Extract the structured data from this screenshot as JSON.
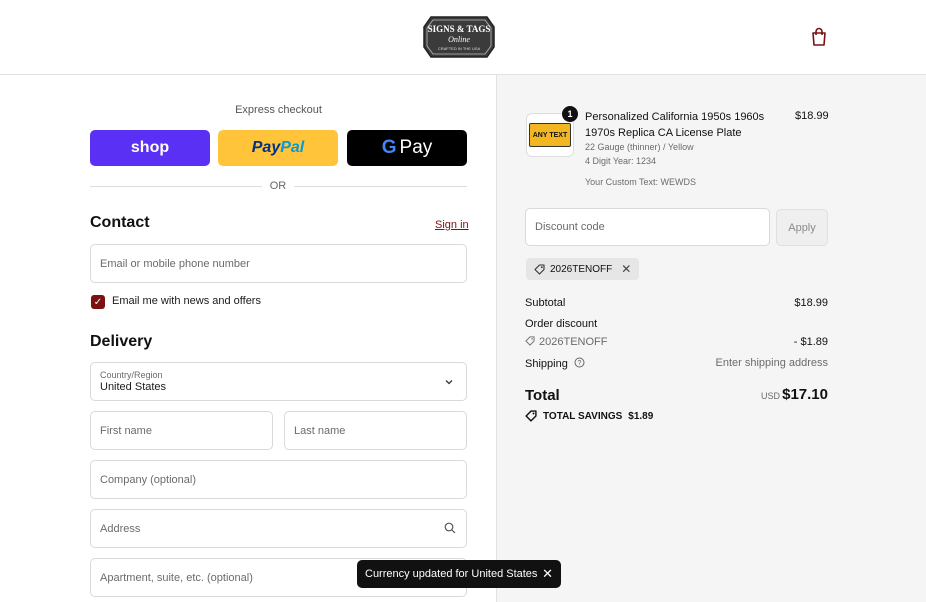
{
  "header": {
    "logo_line1": "SIGNS & TAGS",
    "logo_line2": "Online",
    "logo_line3": "CRAFTED IN THE USA"
  },
  "express": {
    "title": "Express checkout",
    "shop_label": "shop",
    "paypal_part1": "Pay",
    "paypal_part2": "Pal",
    "gpay_g": "G",
    "gpay_label": "Pay",
    "or_label": "OR"
  },
  "contact": {
    "title": "Contact",
    "signin_label": "Sign in",
    "email_placeholder": "Email or mobile phone number",
    "newsletter_label": "Email me with news and offers",
    "newsletter_checked": true
  },
  "delivery": {
    "title": "Delivery",
    "country_label": "Country/Region",
    "country_value": "United States",
    "first_name_placeholder": "First name",
    "last_name_placeholder": "Last name",
    "company_placeholder": "Company (optional)",
    "address_placeholder": "Address",
    "apartment_placeholder": "Apartment, suite, etc. (optional)"
  },
  "toast": {
    "message": "Currency updated for United States"
  },
  "order": {
    "item": {
      "quantity": "1",
      "plate_text": "ANY TEXT",
      "title": "Personalized California 1950s 1960s 1970s Replica CA License Plate",
      "price": "$18.99",
      "variant": "22 Gauge (thinner) / Yellow",
      "digit_year": "4 Digit Year: 1234",
      "custom_text": "Your Custom Text: WEWDS"
    },
    "discount_placeholder": "Discount code",
    "apply_label": "Apply",
    "applied_code": "2026TENOFF",
    "subtotal_label": "Subtotal",
    "subtotal_value": "$18.99",
    "order_discount_label": "Order discount",
    "discount_code_line": "2026TENOFF",
    "discount_value": "- $1.89",
    "shipping_label": "Shipping",
    "shipping_value": "Enter shipping address",
    "total_label": "Total",
    "currency": "USD",
    "total_value": "$17.10",
    "savings_label": "TOTAL SAVINGS",
    "savings_value": "$1.89"
  },
  "colors": {
    "shop_purple": "#5a31f4",
    "paypal_yellow": "#ffc439",
    "accent_maroon": "#7a1212",
    "summary_bg": "#f5f5f5"
  }
}
